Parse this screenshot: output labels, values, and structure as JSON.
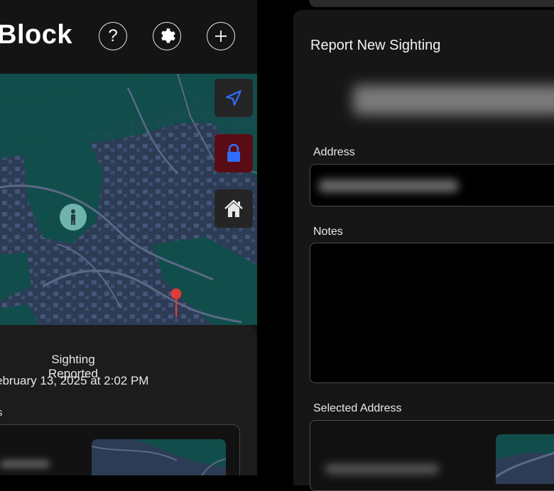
{
  "header": {
    "title": "Block",
    "help_icon": "question-mark-icon",
    "settings_icon": "gear-icon",
    "add_icon": "plus-icon"
  },
  "map": {
    "controls": [
      {
        "name": "locate",
        "icon": "location-arrow-icon"
      },
      {
        "name": "lock",
        "icon": "lock-icon"
      },
      {
        "name": "home",
        "icon": "home-icon"
      }
    ],
    "markers": [
      "person-marker-icon",
      "red-pin-icon"
    ]
  },
  "detail": {
    "status": "Sighting Reported",
    "date": "ebruary 13, 2025 at 2:02 PM",
    "notes_label": "s"
  },
  "form": {
    "title": "Report New Sighting",
    "address_label": "Address",
    "notes_label": "Notes",
    "notes_value": "",
    "selected_address_label": "Selected Address"
  },
  "colors": {
    "map_water": "#114e4b",
    "map_land": "#2d3c55",
    "lock_background": "#5a0c14",
    "accent_blue": "#2f6fff",
    "pin_red": "#e23a3a"
  }
}
